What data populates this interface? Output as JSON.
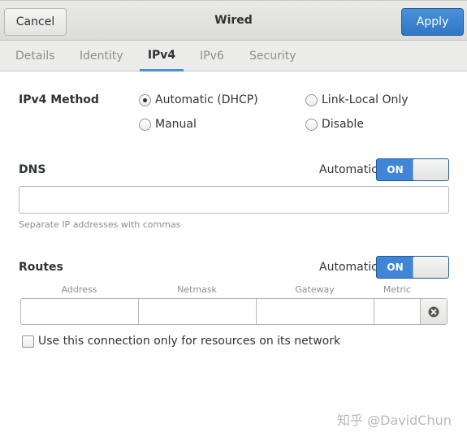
{
  "header": {
    "title": "Wired",
    "cancel_label": "Cancel",
    "apply_label": "Apply"
  },
  "tabs": [
    {
      "label": "Details"
    },
    {
      "label": "Identity"
    },
    {
      "label": "IPv4",
      "active": true
    },
    {
      "label": "IPv6"
    },
    {
      "label": "Security"
    }
  ],
  "ipv4": {
    "method_label": "IPv4 Method",
    "methods": [
      {
        "label": "Automatic (DHCP)",
        "checked": true
      },
      {
        "label": "Link-Local Only",
        "checked": false
      },
      {
        "label": "Manual",
        "checked": false
      },
      {
        "label": "Disable",
        "checked": false
      }
    ]
  },
  "dns": {
    "label": "DNS",
    "automatic_label": "Automatic",
    "switch_label": "ON",
    "value": "",
    "hint": "Separate IP addresses with commas"
  },
  "routes": {
    "label": "Routes",
    "automatic_label": "Automatic",
    "switch_label": "ON",
    "columns": [
      "Address",
      "Netmask",
      "Gateway",
      "Metric"
    ]
  },
  "only_resources": {
    "label": "Use this connection only for resources on its network",
    "checked": false
  },
  "watermark": "知乎 @DavidChun",
  "colors": {
    "accent": "#4a90d9",
    "switch_on": "#3f87d6"
  }
}
